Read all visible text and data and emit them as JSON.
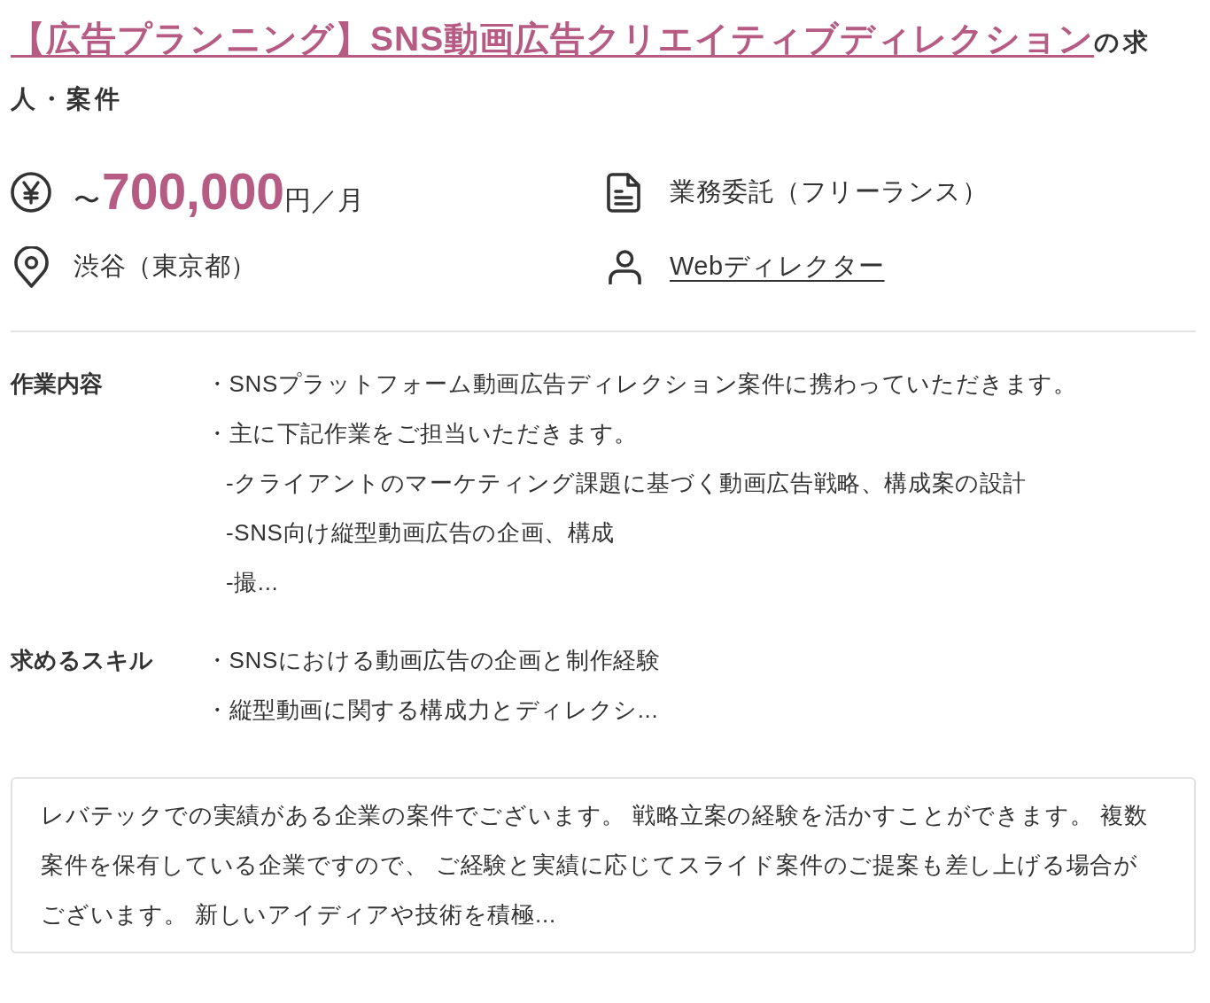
{
  "title": {
    "link": "【広告プランニング】SNS動画広告クリエイティブディレクション",
    "suffix": "の求人・案件"
  },
  "summary": [
    {
      "kind": "salary",
      "prefix": "〜",
      "amount": "700,000",
      "unit": "円／月"
    },
    {
      "kind": "contract",
      "text": "業務委託（フリーランス）"
    },
    {
      "kind": "location",
      "text": "渋谷（東京都）"
    },
    {
      "kind": "occupation",
      "text": "Webディレクター"
    }
  ],
  "sections": [
    {
      "label": "作業内容",
      "items": [
        {
          "text": "・SNSプラットフォーム動画広告ディレクション案件に携わっていただきます。"
        },
        {
          "text": "・主に下記作業をご担当いただきます。",
          "children": [
            {
              "text": "-クライアントのマーケティング課題に基づく動画広告戦略、構成案の設計"
            },
            {
              "text": "-SNS向け縦型動画広告の企画、構成"
            },
            {
              "text": "-撮..."
            }
          ]
        }
      ]
    },
    {
      "label": "求めるスキル",
      "items": [
        {
          "text": "・SNSにおける動画広告の企画と制作経験"
        },
        {
          "text": "・縦型動画に関する構成力とディレクシ..."
        }
      ]
    }
  ],
  "note": "レバテックでの実績がある企業の案件でございます。 戦略立案の経験を活かすことができます。 複数案件を保有している企業ですので、 ご経験と実績に応じてスライド案件のご提案も差し上げる場合がございます。 新しいアイディアや技術を積極..."
}
